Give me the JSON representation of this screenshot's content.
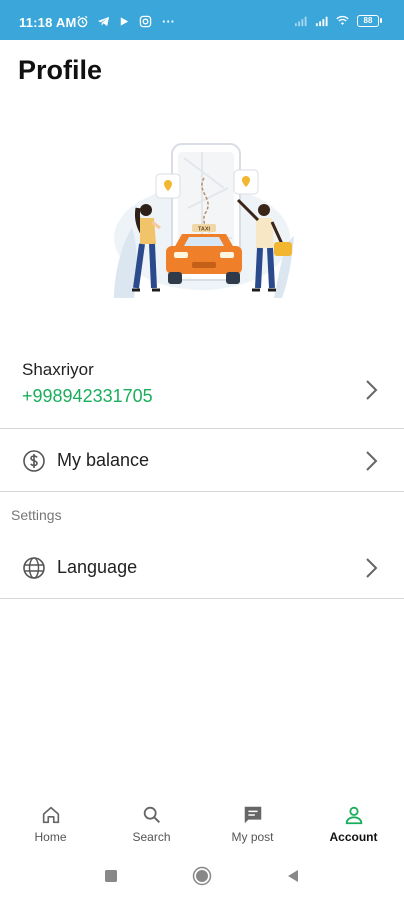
{
  "status_bar": {
    "time": "11:18 AM",
    "more_indicator": "···",
    "battery": "88",
    "left_icons": [
      "alarm-icon",
      "telegram-icon",
      "play-icon",
      "instagram-icon"
    ],
    "right_icons": [
      "signal-icon",
      "signal-icon",
      "wifi-icon",
      "battery-icon"
    ]
  },
  "header": {
    "title": "Profile"
  },
  "user": {
    "name": "Shaxriyor",
    "phone": "+998942331705"
  },
  "menu": {
    "balance_label": "My balance",
    "settings_section": "Settings",
    "language_label": "Language"
  },
  "illustration": {
    "taxi_sign": "TAXI"
  },
  "bottom_nav": {
    "items": [
      {
        "label": "Home",
        "icon": "home-icon"
      },
      {
        "label": "Search",
        "icon": "search-icon"
      },
      {
        "label": "My post",
        "icon": "chat-icon"
      },
      {
        "label": "Account",
        "icon": "account-icon",
        "active": true
      }
    ]
  },
  "colors": {
    "status_bar": "#3ba6d9",
    "accent_green": "#1aae5c",
    "taxi_orange": "#f07f2a"
  }
}
